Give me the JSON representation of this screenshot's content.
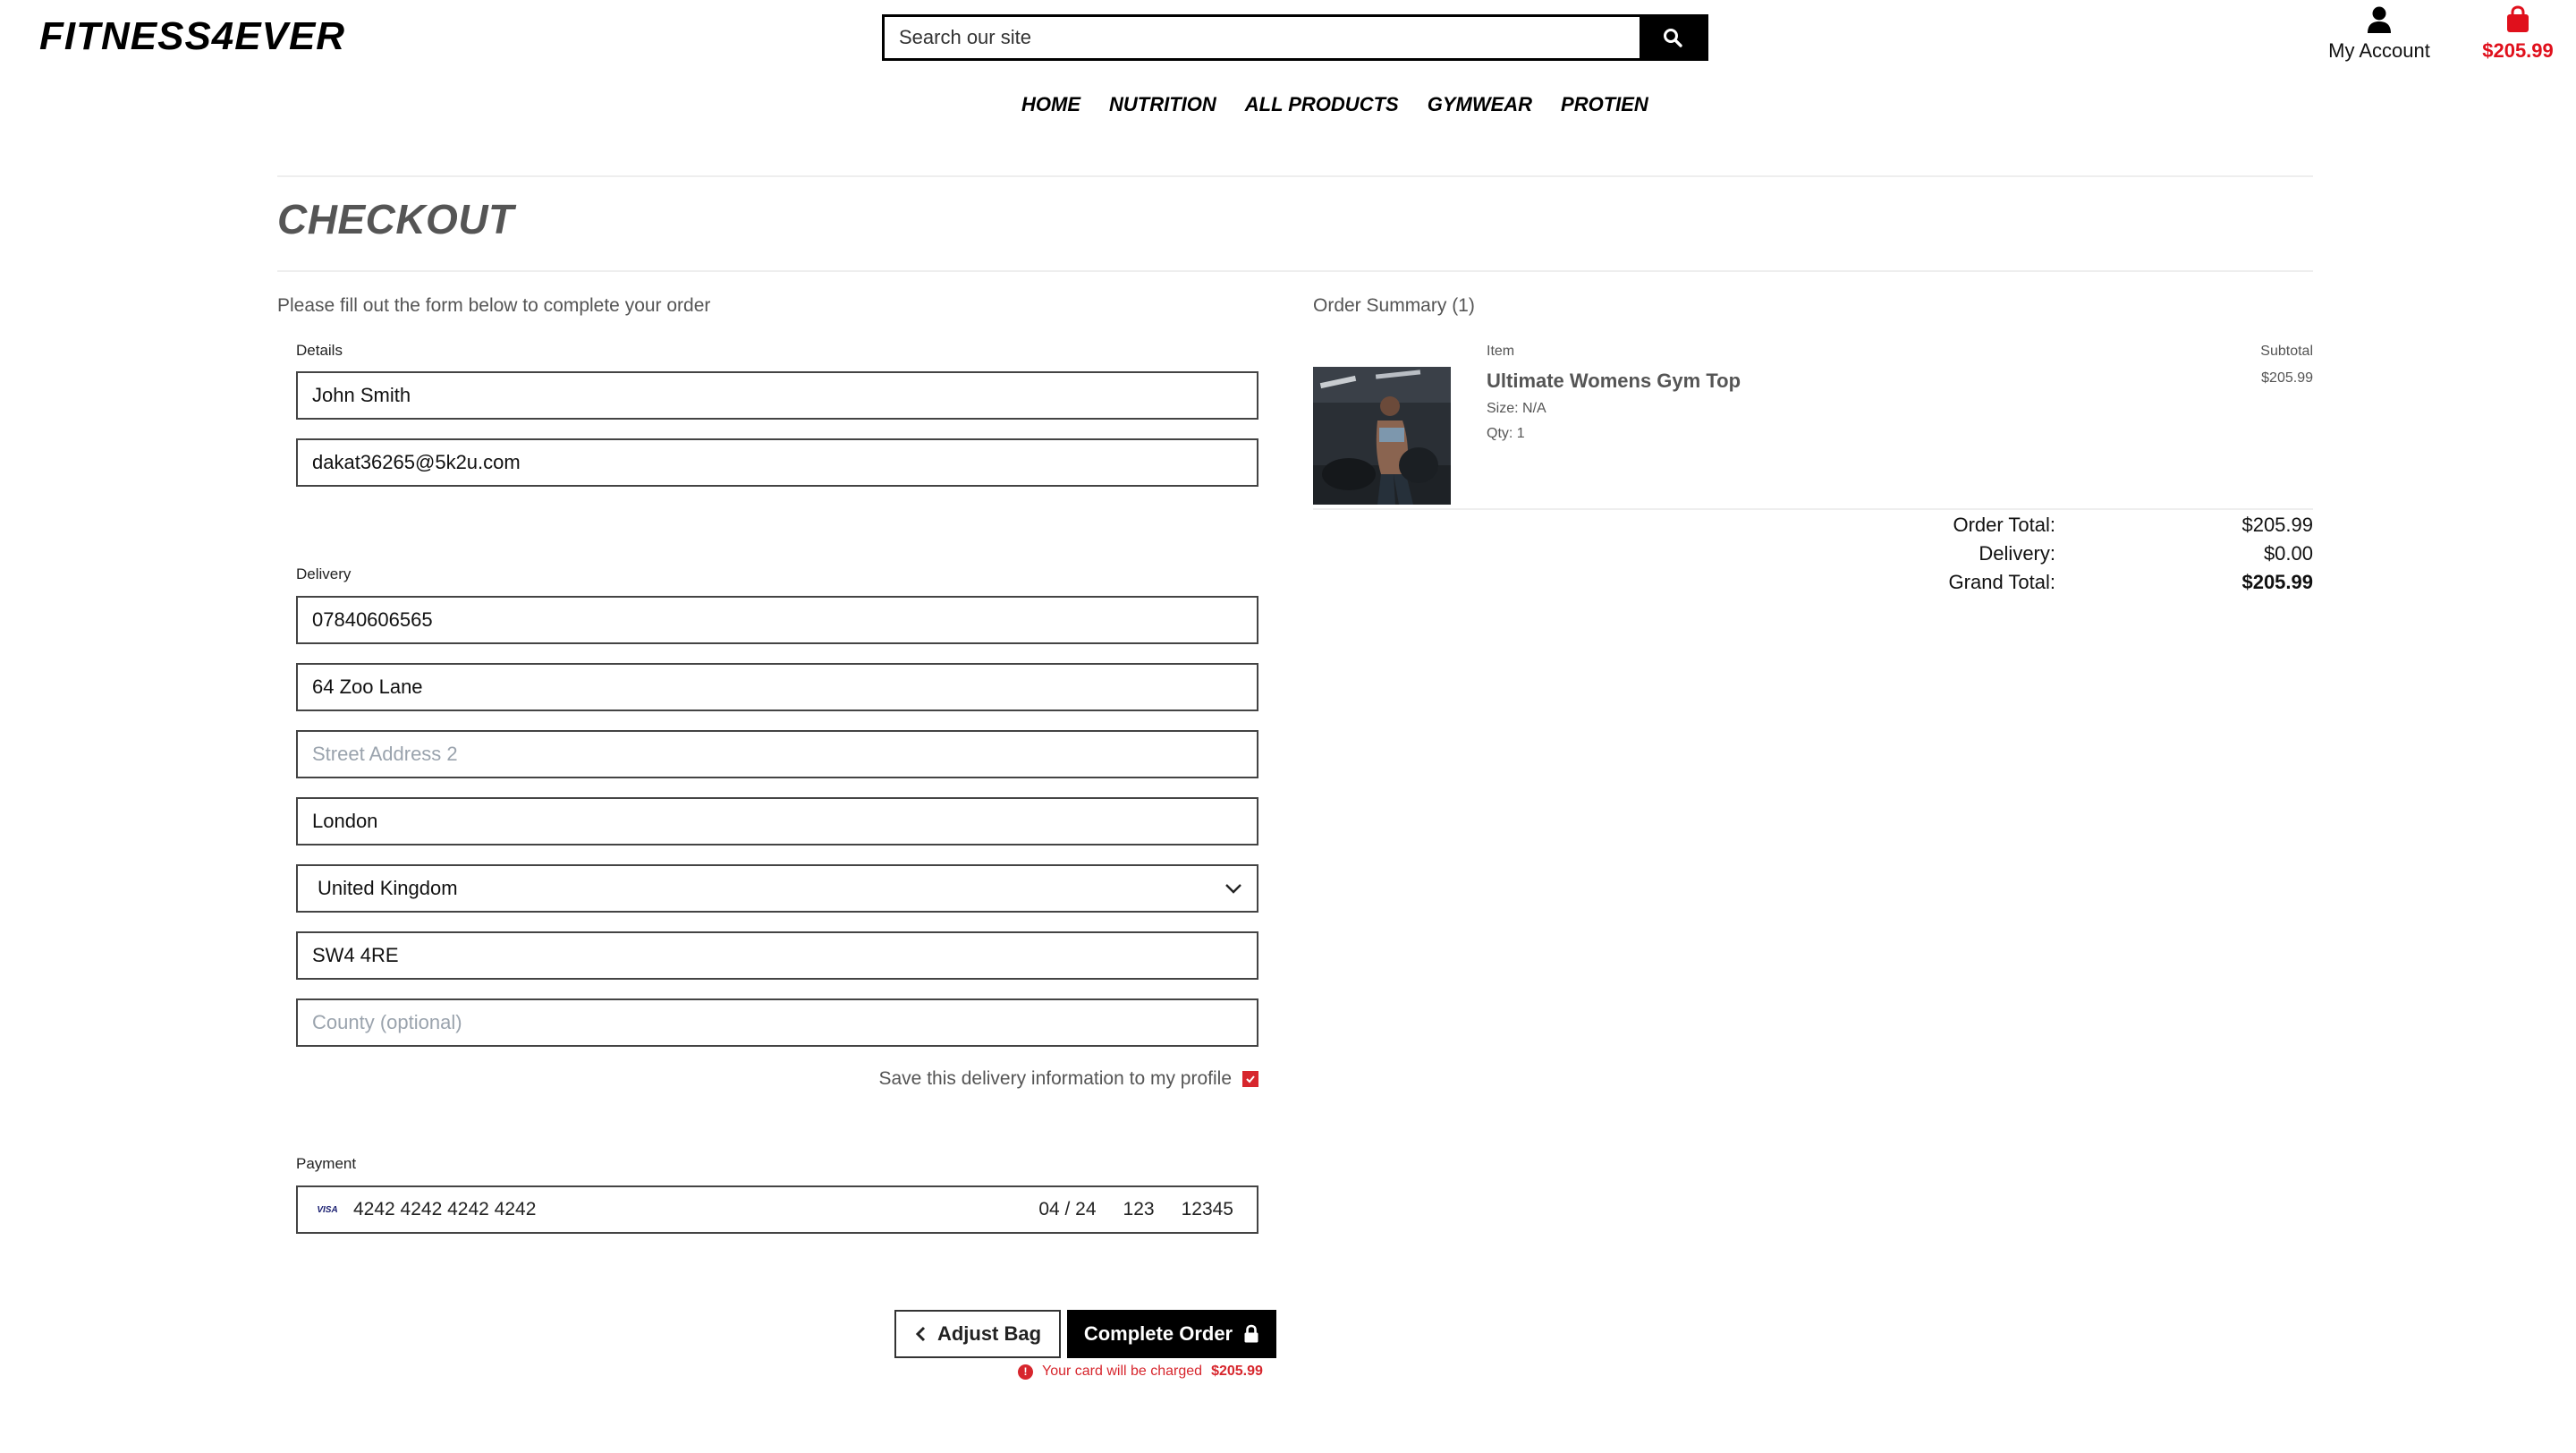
{
  "header": {
    "logo": "FITNESS4EVER",
    "search_placeholder": "Search our site",
    "account_label": "My Account",
    "bag_total": "$205.99",
    "nav": [
      "HOME",
      "NUTRITION",
      "ALL PRODUCTS",
      "GYMWEAR",
      "PROTIEN"
    ]
  },
  "page": {
    "title": "CHECKOUT",
    "intro": "Please fill out the form below to complete your order"
  },
  "details": {
    "label": "Details",
    "full_name": "John Smith",
    "email": "dakat36265@5k2u.com"
  },
  "delivery": {
    "label": "Delivery",
    "phone": "07840606565",
    "street1": "64 Zoo Lane",
    "street2_placeholder": "Street Address 2",
    "city": "London",
    "country": "United Kingdom",
    "postcode": "SW4 4RE",
    "county_placeholder": "County (optional)",
    "save_label": "Save this delivery information to my profile",
    "save_checked": true
  },
  "payment": {
    "label": "Payment",
    "card_brand": "VISA",
    "card_number": "4242 4242 4242 4242",
    "expiry": "04 / 24",
    "cvc": "123",
    "zip": "12345"
  },
  "actions": {
    "adjust_label": "Adjust Bag",
    "complete_label": "Complete Order",
    "charge_text": "Your card will be charged",
    "charge_amount": "$205.99"
  },
  "summary": {
    "title": "Order Summary (1)",
    "col_item": "Item",
    "col_subtotal": "Subtotal",
    "product": {
      "name": "Ultimate Womens Gym Top",
      "size": "Size: N/A",
      "qty": "Qty: 1",
      "price": "$205.99"
    },
    "totals": {
      "order_total_label": "Order Total:",
      "order_total": "$205.99",
      "delivery_label": "Delivery:",
      "delivery": "$0.00",
      "grand_total_label": "Grand Total:",
      "grand_total": "$205.99"
    }
  },
  "colors": {
    "accent_red": "#e0101c",
    "black": "#000000",
    "muted": "#555555"
  }
}
